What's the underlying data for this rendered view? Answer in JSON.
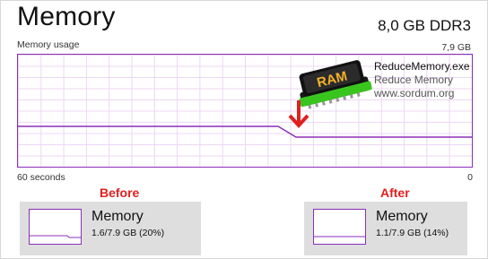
{
  "header": {
    "title": "Memory",
    "spec": "8,0 GB DDR3"
  },
  "graph": {
    "label": "Memory usage",
    "max_label": "7,9 GB",
    "left_time_label": "60 seconds",
    "right_time_label": "0",
    "accent": "#8b2fb8",
    "grid_color": "#ecd7f3",
    "usage_before_percent": 20,
    "usage_after_percent": 14
  },
  "overlay": {
    "app_name": "ReduceMemory.exe",
    "app_subtitle": "Reduce Memory",
    "site": "www.sordum.org",
    "ram_chip_text": "RAM",
    "arrow_icon": "down-arrow-icon",
    "arrow_color": "#e02020"
  },
  "comparison": {
    "before": {
      "caption": "Before",
      "title": "Memory",
      "value": "1.6/7.9 GB (20%)"
    },
    "after": {
      "caption": "After",
      "title": "Memory",
      "value": "1.1/7.9 GB (14%)"
    }
  }
}
